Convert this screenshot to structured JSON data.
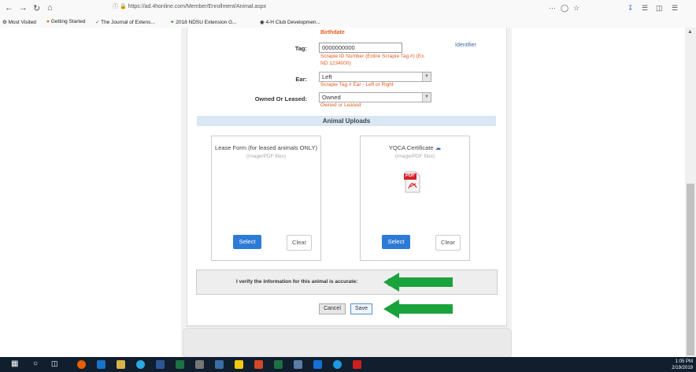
{
  "browser": {
    "url": "https://ad.4honline.com/Member/Enrollment/Animal.aspx",
    "bookmarks": [
      "Most Visited",
      "Getting Started",
      "The Journal of Extens...",
      "2018 NDSU Extension G...",
      "4-H Club Developmen..."
    ]
  },
  "form": {
    "birthdate_hint": "Birthdate",
    "tag_label": "Tag:",
    "tag_value": "0000000000",
    "tag_hint_line1": "Scrapie ID Number (Entire Scrapie Tag #) (Ex.",
    "tag_hint_line2": "ND 1234000)",
    "identifier_link": "Identifier",
    "ear_label": "Ear:",
    "ear_value": "Left",
    "ear_hint": "Scrapie Tag # Ear - Left or Right",
    "owned_label": "Owned Or Leased:",
    "owned_value": "Owned",
    "owned_hint": "Owned or Leased"
  },
  "uploads": {
    "section_title": "Animal Uploads",
    "lease": {
      "title": "Lease Form (for leased animals ONLY)",
      "sub": "(image/PDF files)",
      "select": "Select",
      "clear": "Clear"
    },
    "yqca": {
      "title": "YQCA Certificate",
      "sub": "(image/PDF files)",
      "pdf_label": "PDF",
      "select": "Select",
      "clear": "Clear"
    }
  },
  "verify": {
    "text": "I verify the information for this animal is accurate:",
    "checked": true
  },
  "actions": {
    "cancel": "Cancel",
    "save": "Save"
  },
  "clock": {
    "time": "1:05 PM",
    "date": "2/19/2019"
  },
  "colors": {
    "arrow": "#1aa33c",
    "primary": "#2e7bd6",
    "hint": "#e55a1f",
    "section_header": "#d9e6f4"
  }
}
